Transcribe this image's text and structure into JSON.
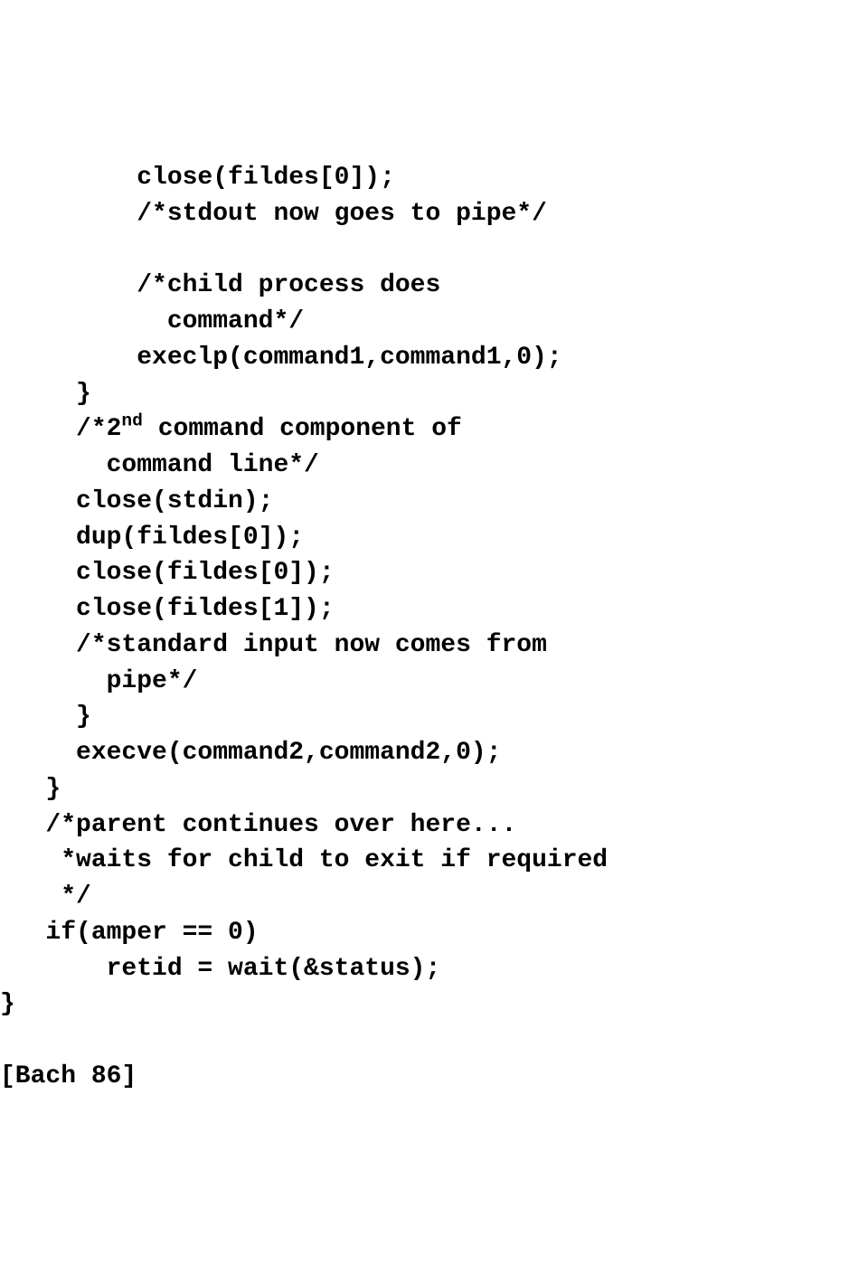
{
  "code": {
    "l1": "         close(fildes[0]);",
    "l2": "         /*stdout now goes to pipe*/",
    "l3": "",
    "l4": "         /*child process does",
    "l5": "           command*/",
    "l6": "         execlp(command1,command1,0);",
    "l7": "     }",
    "l8a": "     /*2",
    "l8sup": "nd",
    "l8b": " command component of",
    "l9": "       command line*/",
    "l10": "     close(stdin);",
    "l11": "     dup(fildes[0]);",
    "l12": "     close(fildes[0]);",
    "l13": "     close(fildes[1]);",
    "l14": "     /*standard input now comes from",
    "l15": "       pipe*/",
    "l16": "     }",
    "l17": "     execve(command2,command2,0);",
    "l18": "   }",
    "l19": "   /*parent continues over here...",
    "l20": "    *waits for child to exit if required",
    "l21": "    */",
    "l22": "   if(amper == 0)",
    "l23": "       retid = wait(&status);",
    "l24": "}",
    "l25": "",
    "l26": "[Bach 86]"
  }
}
